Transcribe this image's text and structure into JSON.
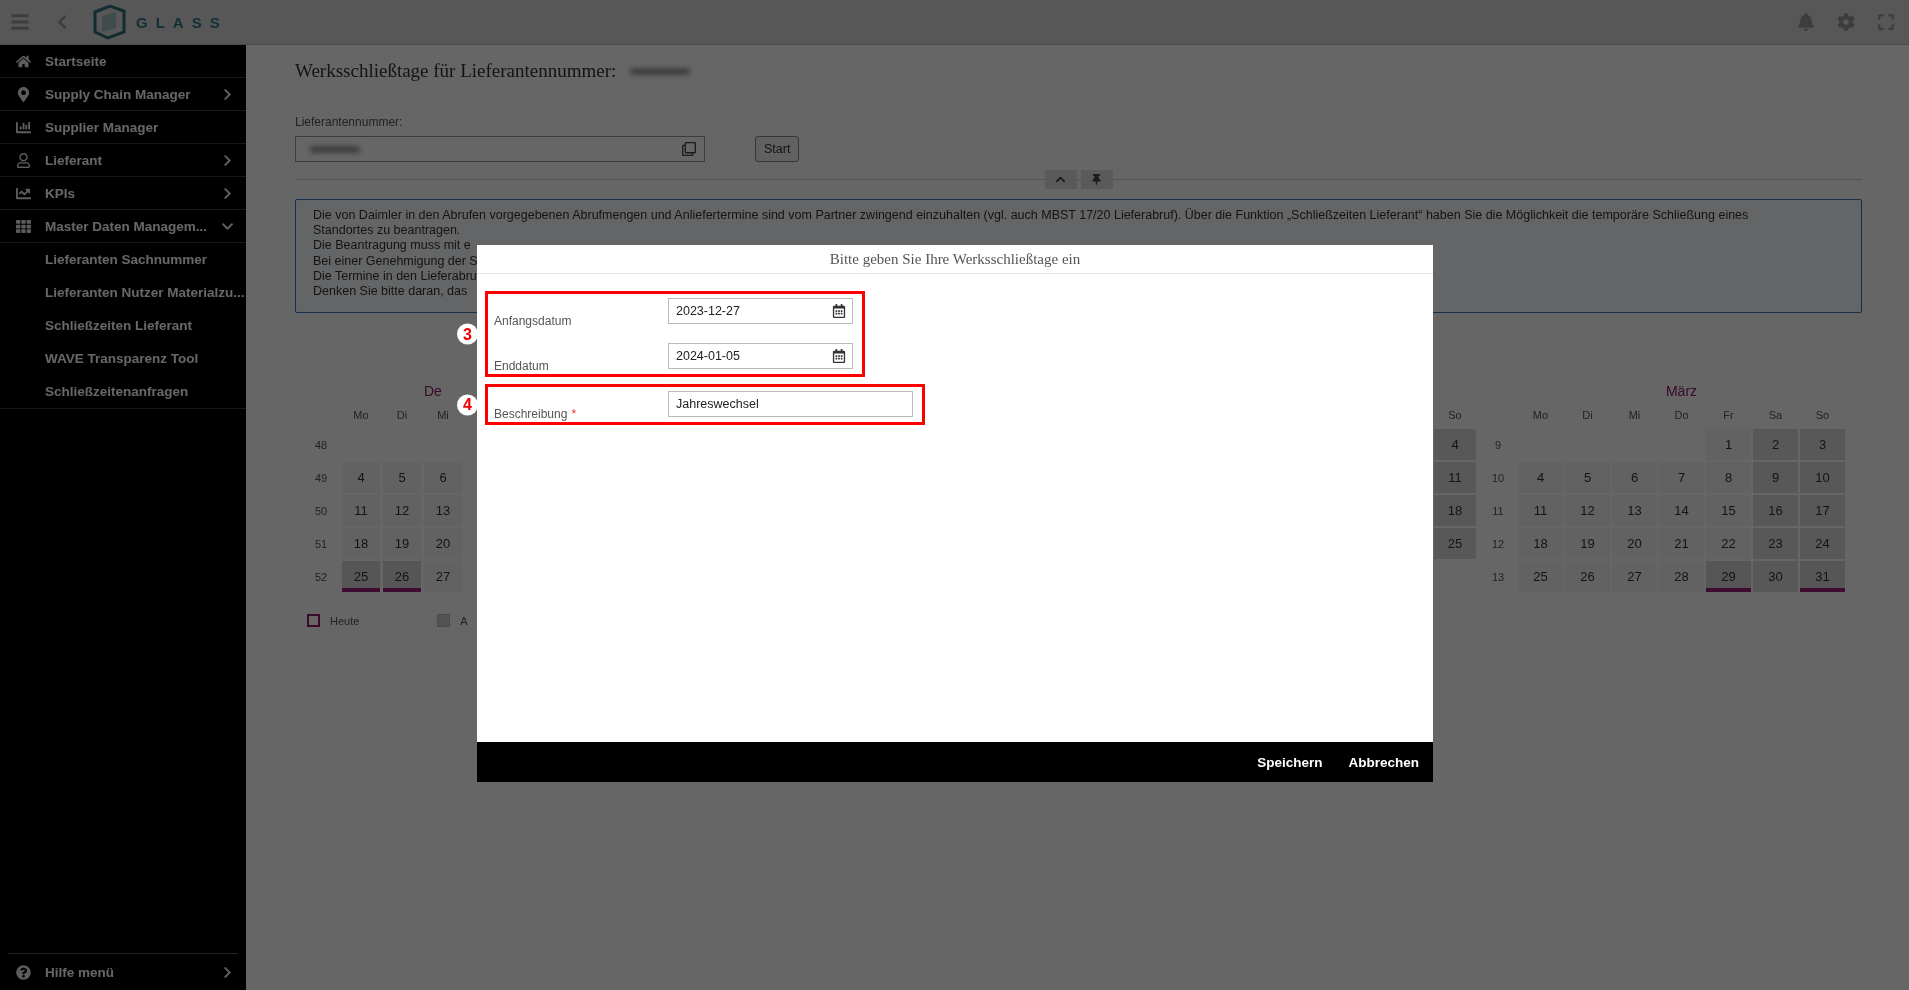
{
  "header": {
    "logo": "GLASS"
  },
  "sidebar": {
    "items": [
      {
        "label": "Startseite",
        "kind": "link"
      },
      {
        "label": "Supply Chain Manager",
        "kind": "group",
        "expanded": false
      },
      {
        "label": "Supplier Manager",
        "kind": "link"
      },
      {
        "label": "Lieferant",
        "kind": "group",
        "expanded": false
      },
      {
        "label": "KPIs",
        "kind": "group",
        "expanded": false
      },
      {
        "label": "Master Daten Managem...",
        "kind": "group",
        "expanded": true,
        "children": [
          {
            "label": "Lieferanten Sachnummer"
          },
          {
            "label": "Lieferanten Nutzer Materialzu..."
          },
          {
            "label": "Schließzeiten Lieferant"
          },
          {
            "label": "WAVE Transparenz Tool"
          },
          {
            "label": "Schließzeitenanfragen"
          }
        ]
      }
    ],
    "footer": {
      "label": "Hilfe menü"
    }
  },
  "page": {
    "title": "Werksschließtage für Lieferantennummer:",
    "field_label": "Lieferantennummer:",
    "start_button": "Start"
  },
  "info_lines": [
    "Die von Daimler in den Abrufen vorgegebenen Abrufmengen und Anliefertermine sind vom Partner zwingend einzuhalten (vgl. auch MBST 17/20 Lieferabruf). Über die Funktion „Schließzeiten Lieferant“ haben Sie die Möglichkeit die temporäre Schließung eines",
    "Standortes zu beantragen.",
    "Die Beantragung muss mit e",
    "Bei einer Genehmigung der S",
    "Die Termine in den Lieferabru",
    "Denken Sie bitte daran, das"
  ],
  "calendar": {
    "left": {
      "title": "De",
      "weekdays": [
        "Mo",
        "Di",
        "Mi"
      ],
      "weeks": [
        {
          "week": "48",
          "days": [
            {
              "kind": "blank"
            },
            {
              "kind": "blank"
            },
            {
              "kind": "blank"
            }
          ]
        },
        {
          "week": "49",
          "days": [
            {
              "day": "4",
              "kind": "weekday"
            },
            {
              "day": "5",
              "kind": "weekday"
            },
            {
              "day": "6",
              "kind": "weekday"
            }
          ]
        },
        {
          "week": "50",
          "days": [
            {
              "day": "11",
              "kind": "weekday"
            },
            {
              "day": "12",
              "kind": "weekday"
            },
            {
              "day": "13",
              "kind": "weekday"
            }
          ]
        },
        {
          "week": "51",
          "days": [
            {
              "day": "18",
              "kind": "weekday"
            },
            {
              "day": "19",
              "kind": "weekday"
            },
            {
              "day": "20",
              "kind": "weekday"
            }
          ]
        },
        {
          "week": "52",
          "days": [
            {
              "day": "25",
              "kind": "holiday"
            },
            {
              "day": "26",
              "kind": "holiday"
            },
            {
              "day": "27",
              "kind": "weekday"
            }
          ]
        }
      ]
    },
    "partial": {
      "weekdays": [
        "So"
      ],
      "weeks": [
        {
          "days": [
            {
              "day": "4",
              "kind": "weekend"
            }
          ]
        },
        {
          "days": [
            {
              "day": "11",
              "kind": "weekend"
            }
          ]
        },
        {
          "days": [
            {
              "day": "18",
              "kind": "weekend"
            }
          ]
        },
        {
          "days": [
            {
              "day": "25",
              "kind": "weekend"
            }
          ]
        },
        {
          "days": [
            {
              "kind": "blank"
            }
          ]
        }
      ]
    },
    "right": {
      "title": "März",
      "weekdays": [
        "Mo",
        "Di",
        "Mi",
        "Do",
        "Fr",
        "Sa",
        "So"
      ],
      "weeks": [
        {
          "week": "9",
          "days": [
            {
              "kind": "blank"
            },
            {
              "kind": "blank"
            },
            {
              "kind": "blank"
            },
            {
              "kind": "blank"
            },
            {
              "day": "1",
              "kind": "weekday"
            },
            {
              "day": "2",
              "kind": "weekend"
            },
            {
              "day": "3",
              "kind": "weekend"
            }
          ]
        },
        {
          "week": "10",
          "days": [
            {
              "day": "4",
              "kind": "weekday"
            },
            {
              "day": "5",
              "kind": "weekday"
            },
            {
              "day": "6",
              "kind": "weekday"
            },
            {
              "day": "7",
              "kind": "weekday"
            },
            {
              "day": "8",
              "kind": "weekday"
            },
            {
              "day": "9",
              "kind": "weekend"
            },
            {
              "day": "10",
              "kind": "weekend"
            }
          ]
        },
        {
          "week": "11",
          "days": [
            {
              "day": "11",
              "kind": "weekday"
            },
            {
              "day": "12",
              "kind": "weekday"
            },
            {
              "day": "13",
              "kind": "weekday"
            },
            {
              "day": "14",
              "kind": "weekday"
            },
            {
              "day": "15",
              "kind": "weekday"
            },
            {
              "day": "16",
              "kind": "weekend"
            },
            {
              "day": "17",
              "kind": "weekend"
            }
          ]
        },
        {
          "week": "12",
          "days": [
            {
              "day": "18",
              "kind": "weekday"
            },
            {
              "day": "19",
              "kind": "weekday"
            },
            {
              "day": "20",
              "kind": "weekday"
            },
            {
              "day": "21",
              "kind": "weekday"
            },
            {
              "day": "22",
              "kind": "weekday"
            },
            {
              "day": "23",
              "kind": "weekend"
            },
            {
              "day": "24",
              "kind": "weekend"
            }
          ]
        },
        {
          "week": "13",
          "days": [
            {
              "day": "25",
              "kind": "weekday"
            },
            {
              "day": "26",
              "kind": "weekday"
            },
            {
              "day": "27",
              "kind": "weekday"
            },
            {
              "day": "28",
              "kind": "weekday"
            },
            {
              "day": "29",
              "kind": "holiday"
            },
            {
              "day": "30",
              "kind": "weekend"
            },
            {
              "day": "31",
              "kind": "holiday"
            }
          ]
        }
      ]
    },
    "legend": [
      {
        "label": "Heute",
        "kind": "today"
      },
      {
        "label": "A",
        "kind": "closed"
      }
    ]
  },
  "modal": {
    "title": "Bitte geben Sie Ihre Werksschließtage ein",
    "groups": [
      {
        "marker": "3",
        "fields": [
          {
            "label": "Anfangsdatum",
            "value": "2023-12-27",
            "kind": "date"
          },
          {
            "label": "Enddatum",
            "value": "2024-01-05",
            "kind": "date"
          }
        ]
      },
      {
        "marker": "4",
        "fields": [
          {
            "label": "Beschreibung",
            "required_mark": "*",
            "value": "Jahreswechsel",
            "kind": "text"
          }
        ]
      }
    ],
    "buttons": [
      "Speichern",
      "Abbrechen"
    ]
  }
}
